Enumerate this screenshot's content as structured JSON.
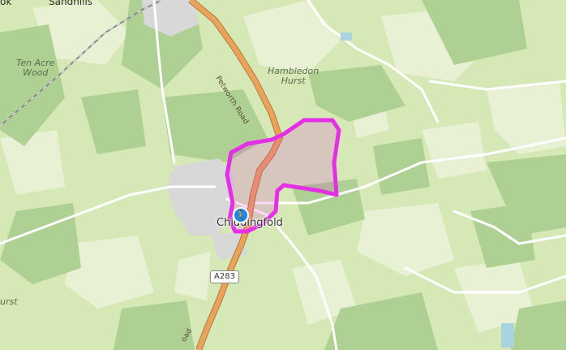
{
  "map": {
    "labels": {
      "sandhills": "Sandhills",
      "ok": "ok",
      "ten_acre_wood_line1": "Ten Acre",
      "ten_acre_wood_line2": "Wood",
      "hambledon_hurst_line1": "Hambledon",
      "hambledon_hurst_line2": "Hurst",
      "hurst": "urst",
      "chiddingfold": "Chiddingfold",
      "petworth_road": "Petworth Road",
      "road": "oad"
    },
    "road_shields": {
      "a283": "A283"
    },
    "route": {
      "color": "#e52fe5"
    },
    "marker": {
      "icon": "hiker-icon",
      "color": "#1e88e5"
    },
    "colors": {
      "farmland": "#d5e8b5",
      "woodland": "#aed092",
      "fields": "#e9f1d4",
      "settlement": "#d8d8d8",
      "main_road": "#eaa35a",
      "minor_road": "#ffffff",
      "railway": "#888888"
    }
  }
}
